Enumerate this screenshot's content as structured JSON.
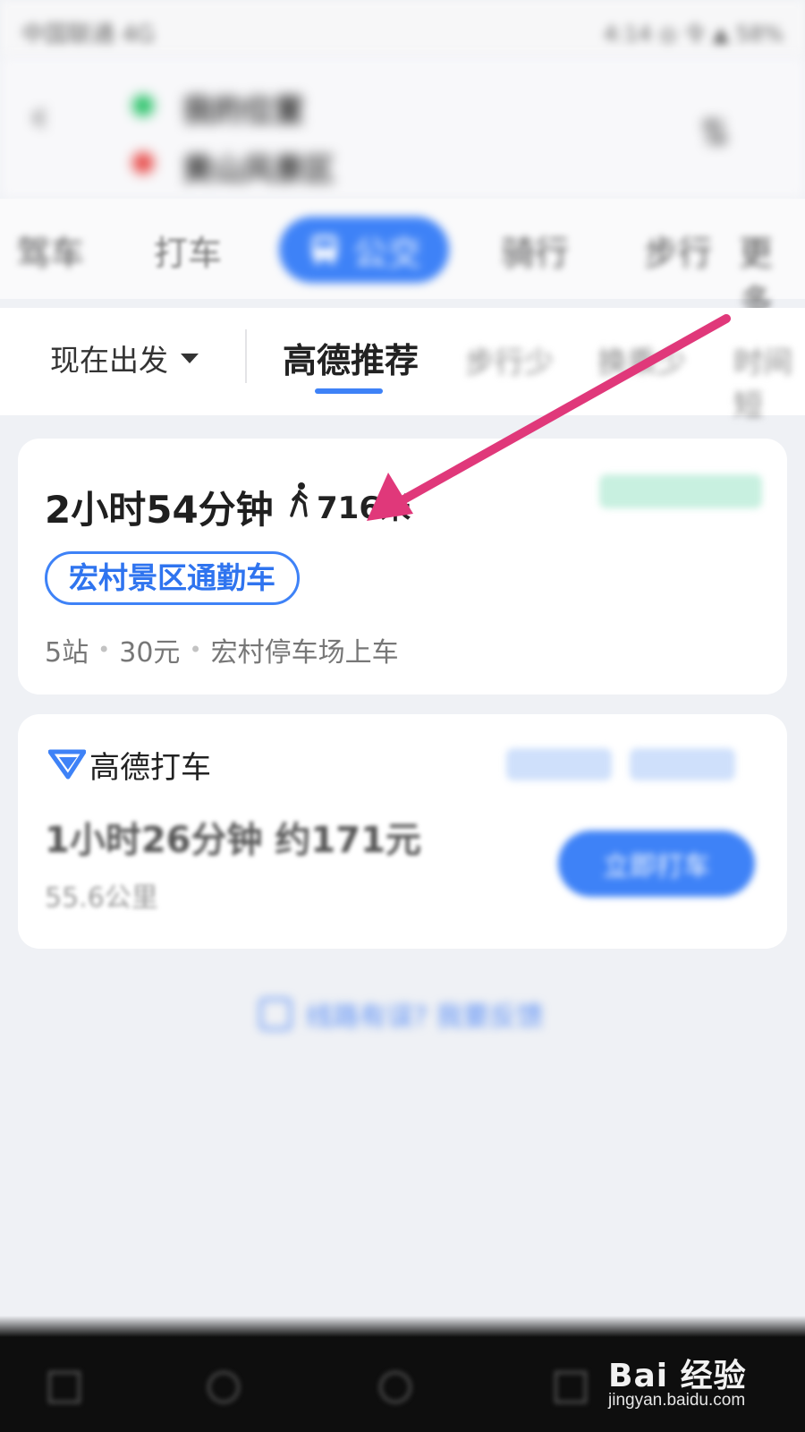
{
  "status_bar": {
    "carrier": "中国联通 4G",
    "right": "4:14 ◎ 令 ▲ 58%"
  },
  "header": {
    "back_icon": "back-arrow-icon",
    "route_start": "我的位置",
    "route_end": "黄山风景区",
    "swap_icon": "swap-icon"
  },
  "mode_tabs": {
    "items": [
      "驾车",
      "打车",
      "公交",
      "骑行",
      "步行",
      "更多"
    ],
    "active_index": 2,
    "active_icon": "bus-icon",
    "active_color": "#3e82f7"
  },
  "filter_bar": {
    "depart": "现在出发",
    "recommend": "高德推荐",
    "sort_options": [
      "步行少",
      "换乘少",
      "时间短"
    ]
  },
  "route_card": {
    "duration": "2小时54分钟",
    "walk_icon": "walking-person-icon",
    "walk_distance": "716米",
    "route_name": "宏村景区通勤车",
    "meta": [
      "5站",
      "30元",
      "宏村停车场上车"
    ],
    "pill_color": "#2f74ef"
  },
  "taxi_card": {
    "logo_icon": "amap-taxi-logo-icon",
    "title": "高德打车",
    "summary": "1小时26分钟 约171元",
    "distance": "55.6公里",
    "button_label": "立即打车"
  },
  "feedback": {
    "icon": "feedback-icon",
    "text": "线路有误? 我要反馈"
  },
  "watermark": {
    "brand": "Bai 经验",
    "url": "jingyan.baidu.com"
  },
  "annotation": {
    "color": "#e0387a"
  }
}
